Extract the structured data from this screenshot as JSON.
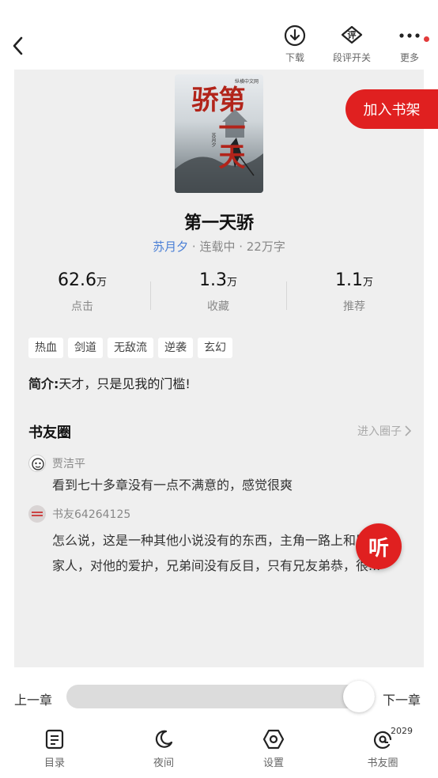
{
  "topbar": {
    "actions": [
      {
        "label": "下载",
        "icon": "download-icon"
      },
      {
        "label": "段评开关",
        "icon": "comment-toggle-icon",
        "glyph": "评"
      },
      {
        "label": "更多",
        "icon": "more-icon"
      }
    ]
  },
  "book": {
    "cover": {
      "title": "第一天骄",
      "publisher": "纵横中文网",
      "author": "苏月夕"
    },
    "add_shelf": "加入书架",
    "title": "第一天骄",
    "author": "苏月夕",
    "status": " · 连载中 · 22万字",
    "stats": [
      {
        "value": "62.6",
        "unit": "万",
        "label": "点击"
      },
      {
        "value": "1.3",
        "unit": "万",
        "label": "收藏"
      },
      {
        "value": "1.1",
        "unit": "万",
        "label": "推荐"
      }
    ],
    "tags": [
      "热血",
      "剑道",
      "无敌流",
      "逆袭",
      "玄幻"
    ],
    "intro_label": "简介:",
    "intro_text": "天才，只是见我的门槛!"
  },
  "circle": {
    "title": "书友圈",
    "enter": "进入圈子",
    "posts": [
      {
        "user": "贾洁平",
        "text": "看到七十多章没有一点不满意的，感觉很爽"
      },
      {
        "user": "书友64264125",
        "text_line1": "怎么说，这是一种其他小说没有的东西，主角一路上和朋友",
        "text_line2": "家人，对他的爱护，兄弟间没有反目，只有兄友弟恭，很..."
      }
    ]
  },
  "listen_label": "听",
  "reader": {
    "prev": "上一章",
    "next": "下一章",
    "progress": 1.0
  },
  "bottom_nav": [
    {
      "label": "目录",
      "icon": "catalog-icon"
    },
    {
      "label": "夜间",
      "icon": "moon-icon"
    },
    {
      "label": "设置",
      "icon": "settings-icon"
    },
    {
      "label": "书友圈",
      "icon": "book-circle-icon",
      "badge": "2029"
    }
  ],
  "colors": {
    "accent": "#e02020",
    "author": "#4a7fd6"
  }
}
